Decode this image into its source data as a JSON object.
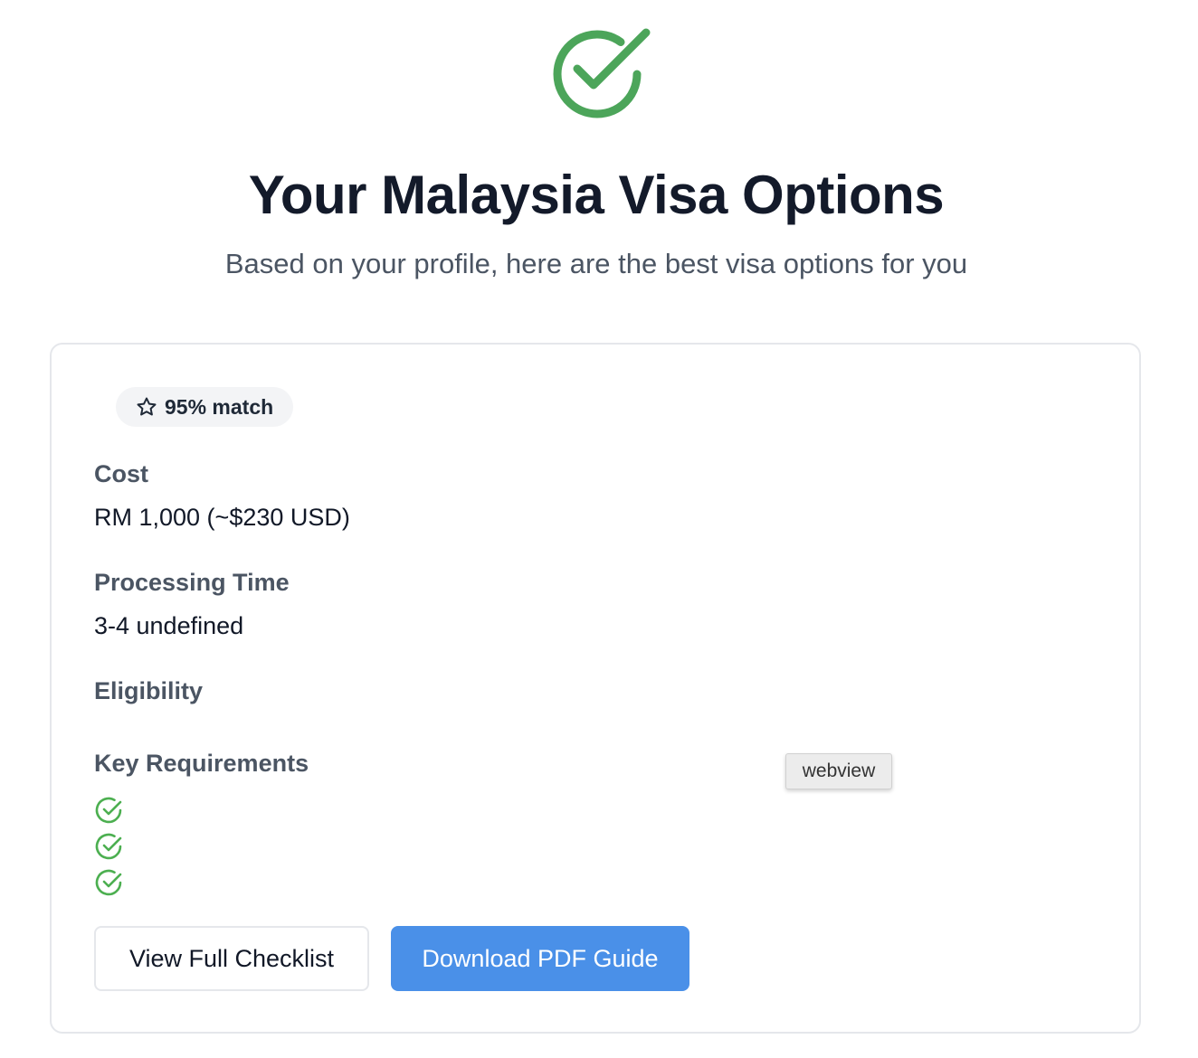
{
  "header": {
    "title": "Your Malaysia Visa Options",
    "subtitle": "Based on your profile, here are the best visa options for you",
    "icon": "check-circle-icon",
    "icon_color": "#4ca55a"
  },
  "card": {
    "match_badge": "95% match",
    "match_icon": "star-icon",
    "cost": {
      "label": "Cost",
      "value": "RM 1,000 (~$230 USD)"
    },
    "processing_time": {
      "label": "Processing Time",
      "value": "3-4 undefined"
    },
    "eligibility": {
      "label": "Eligibility"
    },
    "key_requirements": {
      "label": "Key Requirements",
      "items": [
        "",
        "",
        ""
      ],
      "item_icon": "check-circle-icon",
      "item_icon_color": "#4caf50"
    },
    "buttons": {
      "view_checklist": "View Full Checklist",
      "download_pdf": "Download PDF Guide"
    }
  },
  "overlay": {
    "webview_label": "webview"
  },
  "colors": {
    "primary_button": "#4a90e8",
    "success": "#4ca55a"
  }
}
